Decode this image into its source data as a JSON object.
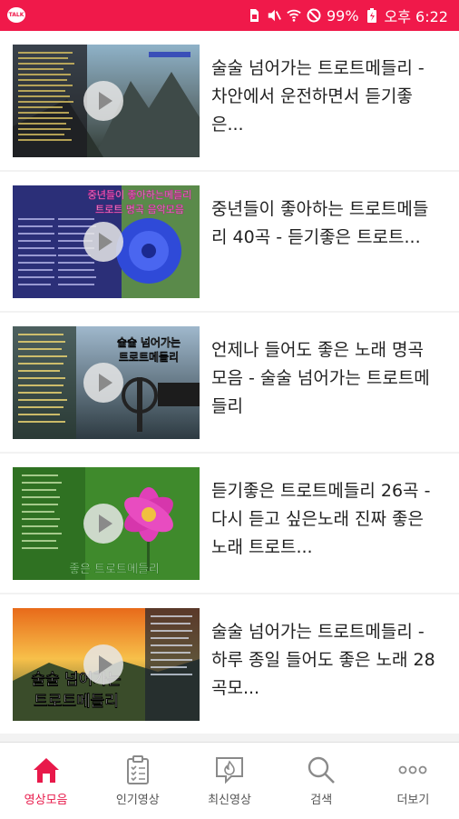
{
  "status_bar": {
    "app_badge": "TALK",
    "battery": "99%",
    "time": "오후 6:22"
  },
  "videos": [
    {
      "title": "술술 넘어가는 트로트메들리 - 차안에서 운전하면서 듣기좋은..."
    },
    {
      "title": "중년들이 좋아하는 트로트메들리 40곡 - 듣기좋은 트로트...",
      "thumb_text": [
        "중년들이 좋아하는메들리",
        "트로트 명곡 음악모음"
      ]
    },
    {
      "title": "언제나 들어도 좋은 노래 명곡모음 - 술술 넘어가는 트로트메들리",
      "thumb_text": [
        "술술 넘어가는",
        "트로트메들리"
      ]
    },
    {
      "title": "듣기좋은 트로트메들리 26곡 - 다시 듣고 싶은노래 진짜 좋은노래 트로트...",
      "thumb_text": [
        "좋은 트로트메들리"
      ]
    },
    {
      "title": "술술 넘어가는 트로트메들리 - 하루 종일 들어도 좋은 노래 28곡모...",
      "thumb_text": [
        "술술 넘어가는",
        "트로트메들리"
      ]
    }
  ],
  "tabs": [
    {
      "label": "영상모음",
      "icon": "home-icon",
      "active": true
    },
    {
      "label": "인기영상",
      "icon": "clipboard-list-icon",
      "active": false
    },
    {
      "label": "최신영상",
      "icon": "fire-chat-icon",
      "active": false
    },
    {
      "label": "검색",
      "icon": "search-icon",
      "active": false
    },
    {
      "label": "더보기",
      "icon": "more-dots-icon",
      "active": false
    }
  ],
  "colors": {
    "accent": "#f0194a",
    "active_tab": "#e8194a"
  }
}
